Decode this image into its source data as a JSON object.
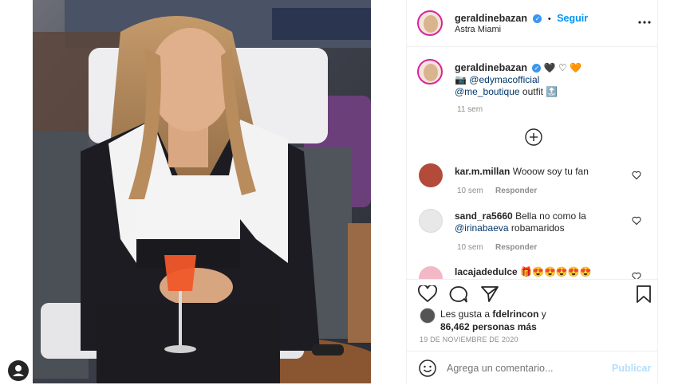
{
  "post_header": {
    "username": "geraldinebazan",
    "verified_mark": "✓",
    "separator": "•",
    "follow_label": "Seguir",
    "location": "Astra Miami",
    "more_icon": "more-horizontal-icon"
  },
  "caption": {
    "username": "geraldinebazan",
    "emoji_hearts": [
      "🖤",
      "♡",
      "🧡"
    ],
    "camera_emoji": "📷",
    "mention_1": "@edymacofficial",
    "mention_2": "@me_boutique",
    "outfit_text": "outfit",
    "tag_emoji": "🔝",
    "time": "11 sem"
  },
  "load_more_icon": "plus-circle-icon",
  "comments": [
    {
      "username": "kar.m.millan",
      "text": "Wooow soy tu fan",
      "time": "10 sem",
      "reply": "Responder"
    },
    {
      "username": "sand_ra5660",
      "text": "Bella no como la",
      "mention": "@irinabaeva",
      "text2": "robamaridos",
      "time": "10 sem",
      "reply": "Responder"
    },
    {
      "username": "lacajadedulce",
      "text": "🎁😍😍😍😍😍"
    }
  ],
  "actions": {
    "like_icon": "heart-icon",
    "comment_icon": "comment-icon",
    "share_icon": "share-icon",
    "save_icon": "bookmark-icon"
  },
  "likes": {
    "prefix": "Les gusta a",
    "user": "fdelrincon",
    "conj": "y",
    "count_text": "86,462 personas más"
  },
  "date": "19 DE NOVIEMBRE DE 2020",
  "comment_box": {
    "placeholder": "Agrega un comentario...",
    "publish_label": "Publicar",
    "emoji_icon": "smiley-icon"
  },
  "colors": {
    "accent": "#0095f6",
    "text": "#262626",
    "muted": "#8e8e8e",
    "border": "#efefef"
  }
}
